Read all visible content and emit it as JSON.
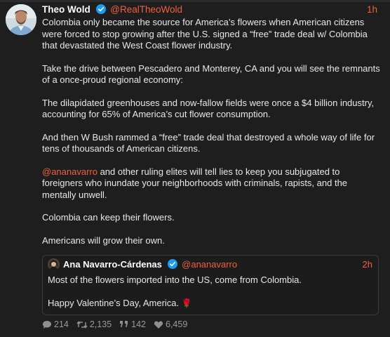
{
  "post": {
    "author_name": "Theo Wold",
    "author_handle": "@RealTheoWold",
    "time": "1h",
    "paragraphs": [
      "Colombia only became the source for America’s flowers when American citizens were forced to stop growing after the U.S. signed a “free” trade deal w/ Colombia that devastated the West Coast flower industry.",
      "Take the drive between Pescadero and Monterey, CA and you will see the remnants of a once-proud regional economy:",
      "The dilapidated greenhouses and now-fallow fields were once a $4 billion industry, accounting for 65% of America’s cut flower consumption.",
      "And then W Bush rammed a “free” trade deal that destroyed a whole way of life for tens of thousands of American citizens."
    ],
    "mention_paragraph": {
      "mention": "@ananavarro",
      "rest": " and other ruling elites will tell lies to keep you subjugated to foreigners who inundate your neighborhoods with criminals, rapists, and the mentally unwell."
    },
    "closing": [
      "Colombia can keep their flowers.",
      "Americans will grow their own."
    ]
  },
  "quote": {
    "author_name": "Ana Navarro-Cárdenas",
    "author_handle": "@ananavarro",
    "time": "2h",
    "line1": "Most of the flowers imported into the US, come from Colombia.",
    "line2": "Happy Valentine’s Day, America.",
    "emoji": "🌹"
  },
  "stats": {
    "replies": "214",
    "reposts": "2,135",
    "quotes": "142",
    "likes": "6,459"
  },
  "colors": {
    "background": "#1e1e1e",
    "accent": "#f0603f",
    "verified": "#1d9bf0",
    "muted": "#9a9a9a"
  },
  "icons": [
    "verified-badge-icon",
    "reply-icon",
    "repost-icon",
    "quote-icon",
    "like-icon"
  ]
}
